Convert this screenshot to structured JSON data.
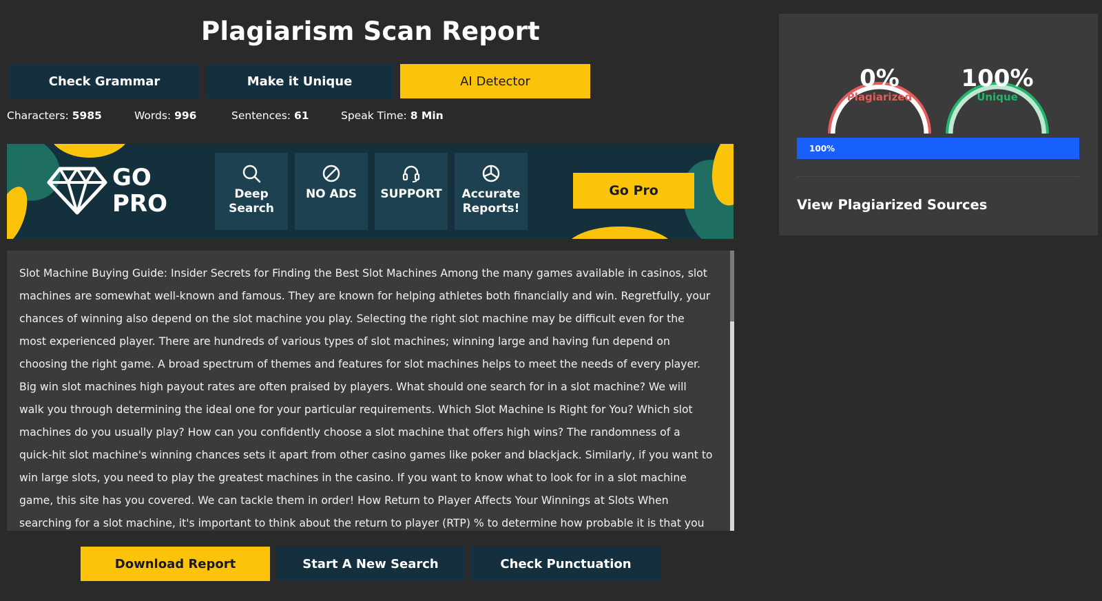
{
  "header": {
    "title": "Plagiarism Scan Report"
  },
  "tools": {
    "check_grammar": "Check Grammar",
    "make_unique": "Make it Unique",
    "ai_detector": "AI Detector"
  },
  "stats": [
    {
      "label": "Characters:",
      "value": "5985"
    },
    {
      "label": "Words:",
      "value": "996"
    },
    {
      "label": "Sentences:",
      "value": "61"
    },
    {
      "label": "Speak Time:",
      "value": "8 Min"
    }
  ],
  "promo": {
    "title_line1": "GO",
    "title_line2": "PRO",
    "features": [
      {
        "icon": "search-icon",
        "line1": "Deep",
        "line2": "Search"
      },
      {
        "icon": "no-ads-icon",
        "line1": "NO ADS",
        "line2": ""
      },
      {
        "icon": "headset-icon",
        "line1": "SUPPORT",
        "line2": ""
      },
      {
        "icon": "pie-chart-icon",
        "line1": "Accurate",
        "line2": "Reports!"
      }
    ],
    "button": "Go Pro",
    "colors": {
      "background": "#15303d",
      "accent": "#fcc30b",
      "leaf": "#1f6e62"
    }
  },
  "content": {
    "text": "Slot Machine Buying Guide: Insider Secrets for Finding the Best Slot Machines Among the many games available in casinos, slot machines are somewhat well-known and famous. They are known for helping athletes both financially and win. Regretfully, your chances of winning also depend on the slot machine you play. Selecting the right slot machine may be difficult even for the most experienced player. There are hundreds of various types of slot machines; winning large and having fun depend on choosing the right game. A broad spectrum of themes and features for slot machines helps to meet the needs of every player. Big win slot machines high payout rates are often praised by players. What should one search for in a slot machine? We will walk you through determining the ideal one for your particular requirements. Which Slot Machine Is Right for You? Which slot machines do you usually play? How can you confidently choose a slot machine that offers high wins? The randomness of a quick-hit slot machine's winning chances sets it apart from other casino games like poker and blackjack. Similarly, if you want to win large slots, you need to play the greatest machines in the casino. If you want to know what to look for in a slot machine game, this site has you covered. We can tackle them in order! How Return to Player Affects Your Winnings at Slots When searching for a slot machine, it's important to think about the return to player (RTP) % to determine how probable it is that you"
  },
  "actions": {
    "download": "Download Report",
    "new_search": "Start A New Search",
    "punctuation": "Check Punctuation"
  },
  "results": {
    "plagiarized": {
      "value": "0%",
      "label": "Plagiarized",
      "color": "#e85b5b",
      "fraction": 0.0
    },
    "unique": {
      "value": "100%",
      "label": "Unique",
      "color": "#22b46a",
      "fraction": 1.0
    },
    "progress": {
      "label": "100%",
      "percent": 100,
      "color": "#1760fb"
    },
    "sources_link": "View Plagiarized Sources"
  }
}
